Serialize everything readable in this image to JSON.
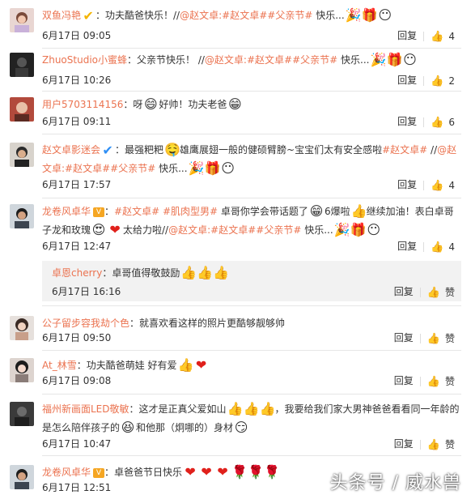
{
  "comments": [
    {
      "user": "双鱼冯艳",
      "text_before": "：功夫酷爸快乐！//",
      "mentions": "@赵文卓:#赵文卓#",
      "topic": "#父亲节#",
      "text_after": " 快乐...",
      "time": "6月17日 09:05",
      "reply_label": "回复",
      "likes": "4"
    },
    {
      "user": "ZhuoStudio小蜜蜂",
      "text_before": "：父亲节快乐！ //",
      "mentions": "@赵文卓:#赵文卓#",
      "topic": "#父亲节#",
      "text_after": " 快乐...",
      "time": "6月17日 10:26",
      "reply_label": "回复",
      "likes": "2"
    },
    {
      "user": "用户5703114156",
      "text_before": "：呀",
      "text_mid": "好帅！功夫老爸",
      "time": "6月17日 09:11",
      "reply_label": "回复",
      "likes": "6"
    },
    {
      "user": "赵文卓影迷会",
      "text_before": "：最强粑粑",
      "text_mid": "雄鹰展翅一般的健硕臂膀~宝宝们太有安全感啦",
      "topic_a": "#赵文卓#",
      "mid2": " //",
      "mention": "@赵文卓:#赵文卓#",
      "topic_b": "#父亲节#",
      "text_after": " 快乐...",
      "time": "6月17日 17:57",
      "reply_label": "回复",
      "likes": "4"
    },
    {
      "user": "龙卷风卓华",
      "sep": "：",
      "topic_a": "#赵文卓#",
      "topic_b": "#肌肉型男#",
      "text_a": " 卓哥你学会带话题了",
      "text_b": "6爆啦",
      "text_c": "继续加油！表白卓哥子龙和玫瑰",
      "text_d": "太给力啦//",
      "mention": "@赵文卓:#赵文卓#",
      "topic_c": "#父亲节#",
      "text_after": " 快乐...",
      "time": "6月17日 12:47",
      "reply_label": "回复",
      "likes": "4"
    },
    {
      "user": "公子留步容我劫个色",
      "text_before": "：就喜欢看这样的照片更酷够靓够帅",
      "time": "6月17日 09:50",
      "reply_label": "回复",
      "likes": "赞"
    },
    {
      "user": "At_林雪",
      "text_before": "：功夫酷爸萌娃 好有爱",
      "time": "6月17日 09:08",
      "reply_label": "回复",
      "likes": "赞"
    },
    {
      "user": "福州新画面LED敬敏",
      "text_before": "：这才是正真父爱如山",
      "text_mid": "，我要给我们家大男神爸爸看看同一年龄的是怎么陪伴孩子的",
      "text_mid2": "和他那（炯哪的）身材",
      "time": "6月17日 10:47",
      "reply_label": "回复",
      "likes": "赞"
    },
    {
      "user": "龙卷风卓华",
      "text_before": "：卓爸爸节日快乐",
      "time": "6月17日 12:51"
    }
  ],
  "nested_reply": {
    "user": "卓恩cherry",
    "text": "：卓哥值得敬鼓励",
    "time": "6月17日 16:16",
    "reply_label": "回复",
    "like_label": "赞"
  },
  "watermark": "头条号 / 威水兽",
  "icons": {
    "like": "thumb-up-icon",
    "party": "party-popper-icon",
    "gift": "gift-icon",
    "face": "mustache-face-icon",
    "grin": "grin-emoji-icon",
    "thumb": "thumbs-up-emoji-icon",
    "heart": "heart-icon",
    "rose": "rose-icon"
  },
  "colors": {
    "username": "#eb7350",
    "topic": "#eb7350",
    "reply_bg": "#f2f2f2"
  }
}
